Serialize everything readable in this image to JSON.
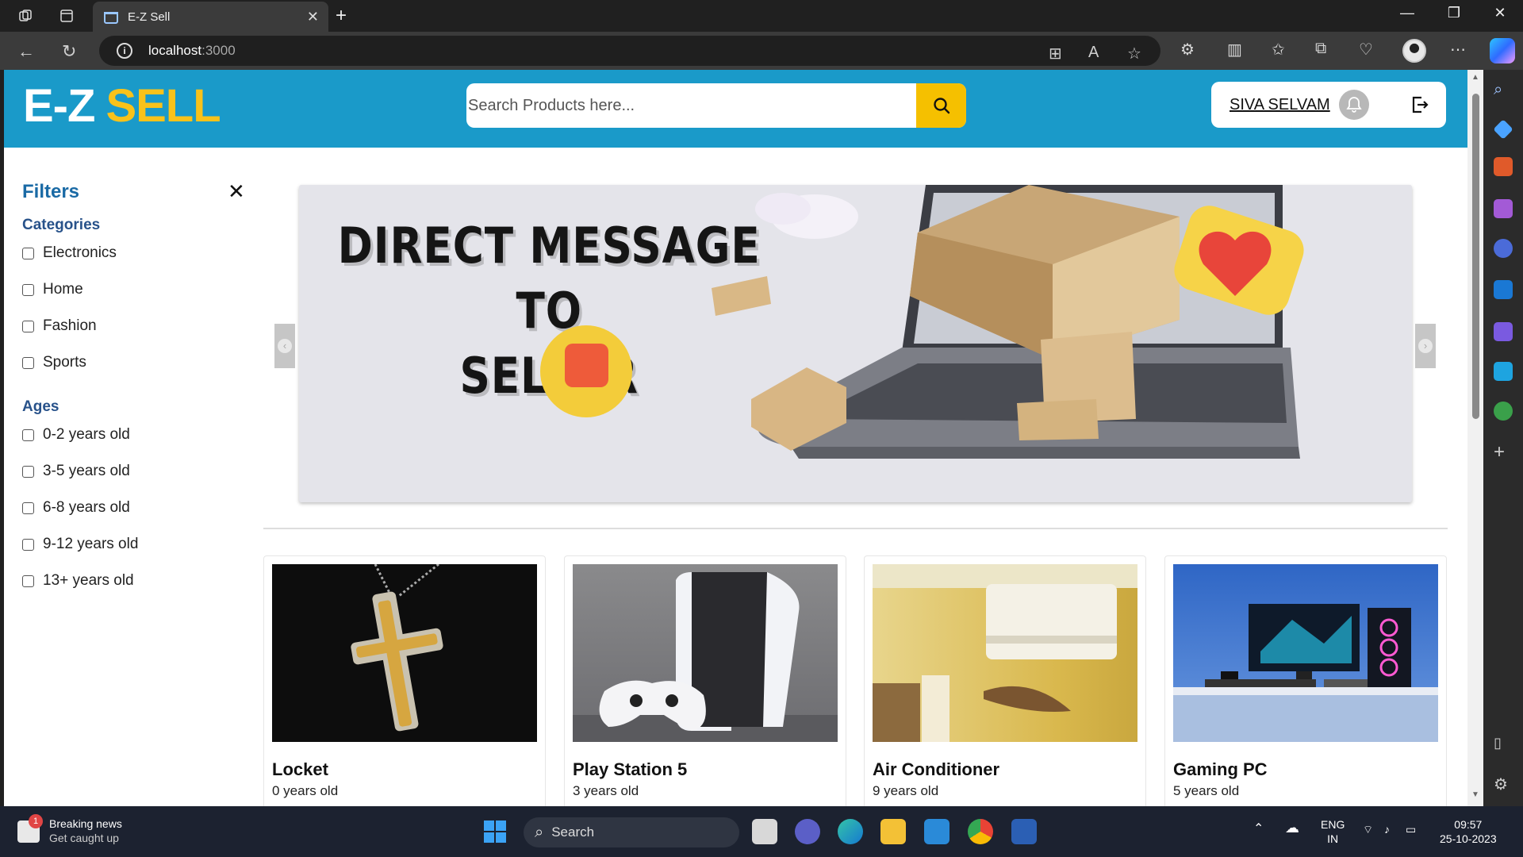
{
  "browser": {
    "tab_title": "E-Z Sell",
    "url_host": "localhost",
    "url_port": ":3000"
  },
  "header": {
    "logo_main": "E-Z",
    "logo_accent": "SELL",
    "search_placeholder": "Search Products here...",
    "user_name": "SIVA SELVAM"
  },
  "filters": {
    "title": "Filters",
    "categories_label": "Categories",
    "categories": [
      "Electronics",
      "Home",
      "Fashion",
      "Sports"
    ],
    "ages_label": "Ages",
    "ages": [
      "0-2 years old",
      "3-5 years old",
      "6-8 years old",
      "9-12 years old",
      "13+ years old"
    ]
  },
  "banner": {
    "line1": "DIRECT MESSAGE TO",
    "line2": "SELLER"
  },
  "products": [
    {
      "name": "Locket",
      "age": "0 years old"
    },
    {
      "name": "Play Station 5",
      "age": "3 years old"
    },
    {
      "name": "Air Conditioner",
      "age": "9 years old"
    },
    {
      "name": "Gaming PC",
      "age": "5 years old"
    }
  ],
  "taskbar": {
    "news_title": "Breaking news",
    "news_sub": "Get caught up",
    "news_badge": "1",
    "search_label": "Search",
    "lang_1": "ENG",
    "lang_2": "IN",
    "time": "09:57",
    "date": "25-10-2023"
  },
  "colors": {
    "header_blue": "#1a9ac9",
    "logo_yellow": "#f8c21a",
    "search_button": "#f5c000",
    "filters_title": "#1a6aa5"
  }
}
